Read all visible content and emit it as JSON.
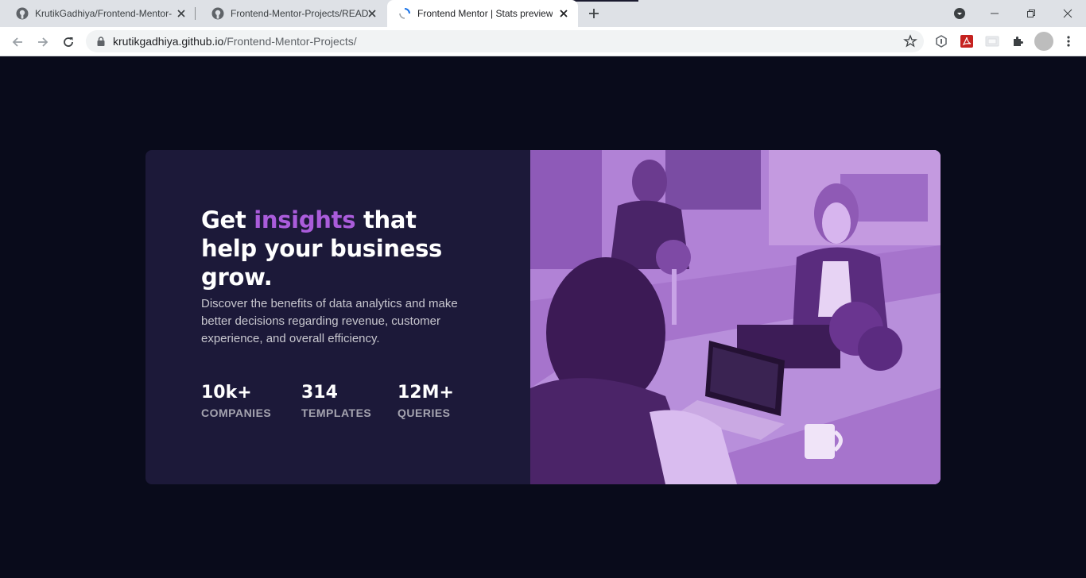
{
  "browser": {
    "tabs": [
      {
        "title": "KrutikGadhiya/Frontend-Mentor-",
        "favicon": "github-icon",
        "active": false
      },
      {
        "title": "Frontend-Mentor-Projects/READM",
        "favicon": "github-icon",
        "active": false
      },
      {
        "title": "Frontend Mentor | Stats preview",
        "favicon": "loading-icon",
        "active": true
      }
    ],
    "url_host": "krutikgadhiya.github.io",
    "url_path": "/Frontend-Mentor-Projects/"
  },
  "card": {
    "headline_before": "Get ",
    "headline_accent": "insights",
    "headline_after": " that help your business grow.",
    "description": "Discover the benefits of data analytics and make better decisions regarding revenue, customer experience, and overall efficiency.",
    "stats": [
      {
        "value": "10k+",
        "label": "COMPANIES"
      },
      {
        "value": "314",
        "label": "TEMPLATES"
      },
      {
        "value": "12M+",
        "label": "QUERIES"
      }
    ],
    "image_alt_icon": "office-team-photo"
  },
  "colors": {
    "page_bg": "#090b1b",
    "card_bg": "#1c1939",
    "accent": "#aa5cdb"
  }
}
